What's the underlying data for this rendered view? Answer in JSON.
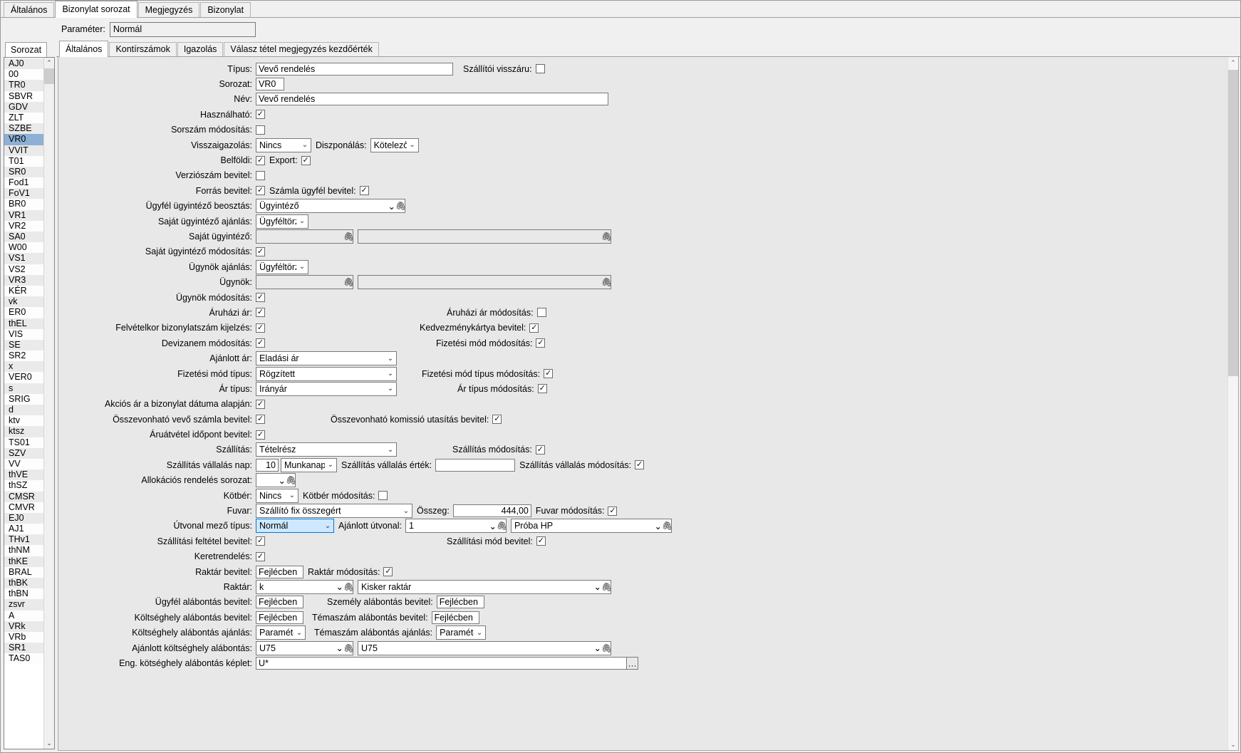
{
  "window": {
    "top_tabs": [
      {
        "label": "Általános",
        "active": false
      },
      {
        "label": "Bizonylat sorozat",
        "active": true
      },
      {
        "label": "Megjegyzés",
        "active": false
      },
      {
        "label": "Bizonylat",
        "active": false
      }
    ],
    "parameter_label": "Paraméter:",
    "parameter_value": "Normál"
  },
  "left_pane": {
    "tab_label": "Sorozat",
    "items": [
      "AJ0",
      "00",
      "TR0",
      "SBVR",
      "GDV",
      "ZLT",
      "SZBE",
      "VR0",
      "VVIT",
      "T01",
      "SR0",
      "Fod1",
      "FoV1",
      "BR0",
      "VR1",
      "VR2",
      "SA0",
      "W00",
      "VS1",
      "VS2",
      "VR3",
      "KÉR",
      "vk",
      "ER0",
      "thEL",
      "VIS",
      "SE",
      "SR2",
      "x",
      "VER0",
      "s",
      "SRIG",
      "d",
      "ktv",
      "ktsz",
      "TS01",
      "SZV",
      "VV",
      "thVE",
      "thSZ",
      "CMSR",
      "CMVR",
      "EJ0",
      "AJ1",
      "THv1",
      "thNM",
      "thKE",
      "BRAL",
      "thBK",
      "thBN",
      "zsvr",
      "A",
      "VRk",
      "VRb",
      "SR1",
      "TAS0"
    ],
    "selected": "VR0"
  },
  "inner_tabs": [
    {
      "label": "Általános",
      "active": true
    },
    {
      "label": "Kontírszámok",
      "active": false
    },
    {
      "label": "Igazolás",
      "active": false
    },
    {
      "label": "Válasz tétel megjegyzés kezdőérték",
      "active": false
    }
  ],
  "form": {
    "tipus_label": "Típus:",
    "tipus_value": "Vevő rendelés",
    "szallitoi_visszaru_label": "Szállítói visszáru:",
    "szallitoi_visszaru_checked": false,
    "sorozat_label": "Sorozat:",
    "sorozat_value": "VR0",
    "nev_label": "Név:",
    "nev_value": "Vevő rendelés",
    "hasznalhato_label": "Használható:",
    "hasznalhato_checked": true,
    "sorszam_modositas_label": "Sorszám módosítás:",
    "sorszam_modositas_checked": false,
    "visszaigazolas_label": "Visszaigazolás:",
    "visszaigazolas_value": "Nincs",
    "diszponalas_label": "Diszponálás:",
    "diszponalas_value": "Kötelező",
    "belfoldi_label": "Belföldi:",
    "belfoldi_checked": true,
    "export_label": "Export:",
    "export_checked": true,
    "verzioszam_label": "Verziószám bevitel:",
    "verzioszam_checked": false,
    "forras_bevitel_label": "Forrás bevitel:",
    "forras_bevitel_checked": true,
    "szamla_ugyfel_label": "Számla ügyfél bevitel:",
    "szamla_ugyfel_checked": true,
    "ugyfel_ugyintezo_beosztas_label": "Ügyfél ügyintéző beosztás:",
    "ugyfel_ugyintezo_beosztas_value": "Ügyintéző",
    "sajat_ugyintezo_ajanlas_label": "Saját ügyintéző ajánlás:",
    "sajat_ugyintezo_ajanlas_value": "Ügyféltörzs",
    "sajat_ugyintezo_label": "Saját ügyintéző:",
    "sajat_ugyintezo_value": "",
    "sajat_ugyintezo_value2": "",
    "sajat_ugyintezo_modositas_label": "Saját ügyintéző módosítás:",
    "sajat_ugyintezo_modositas_checked": true,
    "ugynok_ajanlas_label": "Ügynök ajánlás:",
    "ugynok_ajanlas_value": "Ügyféltörzs",
    "ugynok_label": "Ügynök:",
    "ugynok_value": "",
    "ugynok_value2": "",
    "ugynok_modositas_label": "Ügynök módosítás:",
    "ugynok_modositas_checked": true,
    "aruhazi_ar_label": "Áruházi ár:",
    "aruhazi_ar_checked": true,
    "aruhazi_ar_modositas_label": "Áruházi ár módosítás:",
    "aruhazi_ar_modositas_checked": false,
    "felvetelkor_label": "Felvételkor bizonylatszám kijelzés:",
    "felvetelkor_checked": true,
    "kedvezmenykartya_label": "Kedvezménykártya bevitel:",
    "kedvezmenykartya_checked": true,
    "devizanem_label": "Devizanem módosítás:",
    "devizanem_checked": true,
    "fizetesi_mod_modositas_label": "Fizetési mód módosítás:",
    "fizetesi_mod_modositas_checked": true,
    "ajanlott_ar_label": "Ajánlott ár:",
    "ajanlott_ar_value": "Eladási ár",
    "fizetesi_mod_tipus_label": "Fizetési mód típus:",
    "fizetesi_mod_tipus_value": "Rögzített",
    "fizetesi_mod_tipus_modositas_label": "Fizetési mód típus módosítás:",
    "fizetesi_mod_tipus_modositas_checked": true,
    "ar_tipus_label": "Ár típus:",
    "ar_tipus_value": "Irányár",
    "ar_tipus_modositas_label": "Ár típus módosítás:",
    "ar_tipus_modositas_checked": true,
    "akcios_ar_label": "Akciós ár a bizonylat dátuma alapján:",
    "akcios_ar_checked": true,
    "osszevonhato_vevo_label": "Összevonható vevő számla bevitel:",
    "osszevonhato_vevo_checked": true,
    "osszevonhato_komissio_label": "Összevonható komissió utasítás bevitel:",
    "osszevonhato_komissio_checked": true,
    "aruatvetel_label": "Áruátvétel időpont bevitel:",
    "aruatvetel_checked": true,
    "szallitas_label": "Szállítás:",
    "szallitas_value": "Tételrész",
    "szallitas_modositas_label": "Szállítás módosítás:",
    "szallitas_modositas_checked": true,
    "szallitas_vallalas_nap_label": "Szállítás vállalás nap:",
    "szallitas_vallalas_nap_value": "10",
    "szallitas_vallalas_nap_unit": "Munkanap",
    "szallitas_vallalas_ertek_label": "Szállítás vállalás érték:",
    "szallitas_vallalas_ertek_value": "",
    "szallitas_vallalas_modositas_label": "Szállítás vállalás módosítás:",
    "szallitas_vallalas_modositas_checked": true,
    "allokacios_label": "Allokációs rendelés sorozat:",
    "allokacios_value": "",
    "kotber_label": "Kötbér:",
    "kotber_value": "Nincs",
    "kotber_modositas_label": "Kötbér módosítás:",
    "kotber_modositas_checked": false,
    "fuvar_label": "Fuvar:",
    "fuvar_value": "Szállító fix összegért",
    "osszeg_label": "Összeg:",
    "osszeg_value": "444,00",
    "fuvar_modositas_label": "Fuvar módosítás:",
    "fuvar_modositas_checked": true,
    "utvonal_mezo_tipus_label": "Útvonal mező típus:",
    "utvonal_mezo_tipus_value": "Normál",
    "ajanlott_utvonal_label": "Ajánlott útvonal:",
    "ajanlott_utvonal_value": "1",
    "ajanlott_utvonal_value2": "Próba HP",
    "szallitasi_feltetel_label": "Szállítási feltétel bevitel:",
    "szallitasi_feltetel_checked": true,
    "szallitasi_mod_label": "Szállítási mód bevitel:",
    "szallitasi_mod_checked": true,
    "keretrendeles_label": "Keretrendelés:",
    "keretrendeles_checked": true,
    "raktar_bevitel_label": "Raktár bevitel:",
    "raktar_bevitel_value": "Fejlécben",
    "raktar_modositas_label": "Raktár módosítás:",
    "raktar_modositas_checked": true,
    "raktar_label": "Raktár:",
    "raktar_value": "k",
    "raktar_value2": "Kisker raktár",
    "ugyfel_alabontas_label": "Ügyfél alábontás bevitel:",
    "ugyfel_alabontas_value": "Fejlécben",
    "szemely_alabontas_label": "Személy alábontás bevitel:",
    "szemely_alabontas_value": "Fejlécben",
    "koltseghely_alabontas_label": "Költséghely alábontás bevitel:",
    "koltseghely_alabontas_value": "Fejlécben",
    "temaszam_alabontas_label": "Témaszám alábontás bevitel:",
    "temaszam_alabontas_value": "Fejlécben",
    "koltseghely_ajanlas_label": "Költséghely alábontás ajánlás:",
    "koltseghely_ajanlas_value": "Paraméter",
    "temaszam_ajanlas_label": "Témaszám alábontás ajánlás:",
    "temaszam_ajanlas_value": "Paraméter",
    "ajanlott_koltseghely_label": "Ajánlott költséghely alábontás:",
    "ajanlott_koltseghely_value": "U75",
    "ajanlott_koltseghely_value2": "U75",
    "eng_koltseghely_label": "Eng. kötséghely alábontás képlet:",
    "eng_koltseghely_value": "U*"
  },
  "icons": {
    "clip": "🖇",
    "caret_down": "⌄",
    "caret_up": "⌃",
    "check": "✓",
    "ellipsis": "···"
  }
}
